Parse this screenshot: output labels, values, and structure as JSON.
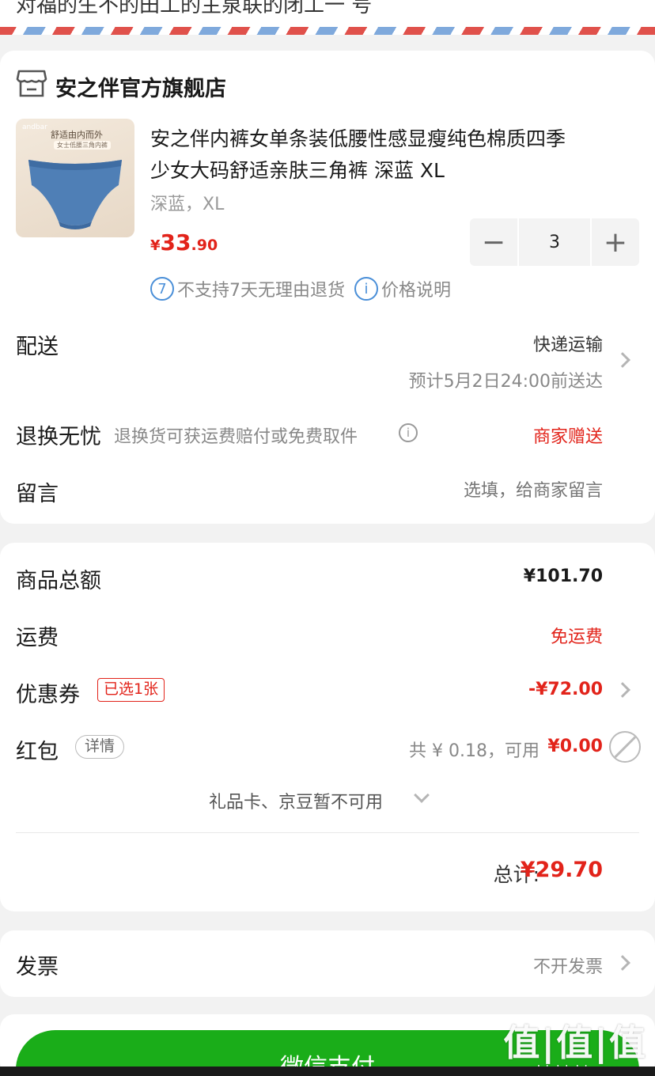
{
  "top": {
    "cut_text": "对福的生不的田工的主泉联的闭工一 号"
  },
  "store": {
    "name": "安之伴官方旗舰店",
    "icon": "store-icon"
  },
  "product": {
    "thumb_brand": "andbar",
    "thumb_banner": "舒适由内而外",
    "thumb_sub": "女士低腰三角内裤",
    "title_line1": "安之伴内裤女单条装低腰性感显瘦纯色棉质四季",
    "title_line2": "少女大码舒适亲肤三角裤 深蓝 XL",
    "spec": "深蓝，XL",
    "price_currency": "¥",
    "price_int": "33",
    "price_dec": ".90",
    "quantity": "3",
    "minus_label": "−",
    "plus_label": "+",
    "no_return_text": "不支持7天无理由退货",
    "price_note_text": "价格说明",
    "no_return_icon_glyph": "7",
    "info_glyph": "i"
  },
  "delivery": {
    "label": "配送",
    "method": "快递运输",
    "eta": "预计5月2日24:00前送达"
  },
  "returns": {
    "label": "退换无忧",
    "desc": "退换货可获运费赔付或免费取件",
    "value": "商家赠送",
    "info_glyph": "i"
  },
  "message": {
    "label": "留言",
    "placeholder": "选填，给商家留言"
  },
  "summary": {
    "goods_label": "商品总额",
    "goods_value": "¥101.70",
    "shipping_label": "运费",
    "shipping_value": "免运费",
    "coupon_label": "优惠券",
    "coupon_tag": "已选1张",
    "coupon_value": "-¥72.00",
    "redpacket_label": "红包",
    "redpacket_tag": "详情",
    "redpacket_total": "共 ¥ 0.18，可用",
    "redpacket_available": "¥0.00",
    "giftcard_text": "礼品卡、京豆暂不可用",
    "total_label": "总计:",
    "total_value": "¥29.70"
  },
  "invoice": {
    "label": "发票",
    "value": "不开发票"
  },
  "pay": {
    "label": "微信支付"
  },
  "watermark": {
    "big": "值|值|值",
    "small": "zhizhizhi.com"
  },
  "colors": {
    "accent_red": "#e2231a",
    "pay_green": "#1aad19",
    "info_blue": "#4a8fd8"
  }
}
